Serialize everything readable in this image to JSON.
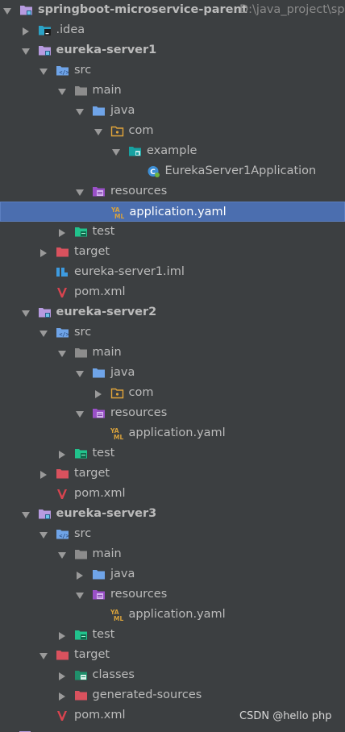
{
  "tree": {
    "rows": [
      {
        "name": "project-root",
        "indent": 0,
        "arrow": "down",
        "icon": "module-folder",
        "label": "springboot-microservice-parent",
        "bold": true,
        "path": "D:\\java_project\\sp"
      },
      {
        "name": "idea-folder",
        "indent": 1,
        "arrow": "right",
        "icon": "idea-folder",
        "label": ".idea"
      },
      {
        "name": "module-eureka-server1",
        "indent": 1,
        "arrow": "down",
        "icon": "module-folder",
        "label": "eureka-server1",
        "bold": true
      },
      {
        "name": "src-folder",
        "indent": 2,
        "arrow": "down",
        "icon": "src-folder",
        "label": "src"
      },
      {
        "name": "main-folder",
        "indent": 3,
        "arrow": "down",
        "icon": "plain-folder",
        "label": "main"
      },
      {
        "name": "java-folder",
        "indent": 4,
        "arrow": "down",
        "icon": "java-folder",
        "label": "java"
      },
      {
        "name": "package-com",
        "indent": 5,
        "arrow": "down",
        "icon": "package-folder",
        "label": "com"
      },
      {
        "name": "package-example",
        "indent": 6,
        "arrow": "down",
        "icon": "package-teal",
        "label": "example"
      },
      {
        "name": "class-eurekaserver1application",
        "indent": 7,
        "arrow": "none",
        "icon": "spring-class",
        "label": "EurekaServer1Application"
      },
      {
        "name": "resources-folder",
        "indent": 4,
        "arrow": "down",
        "icon": "resources-folder",
        "label": "resources"
      },
      {
        "name": "file-application-yaml",
        "indent": 5,
        "arrow": "none",
        "icon": "yaml-file",
        "label": "application.yaml",
        "selected": true
      },
      {
        "name": "test-folder",
        "indent": 3,
        "arrow": "right",
        "icon": "test-folder",
        "label": "test"
      },
      {
        "name": "target-folder",
        "indent": 2,
        "arrow": "right",
        "icon": "target-folder",
        "label": "target"
      },
      {
        "name": "file-eureka-server1-iml",
        "indent": 2,
        "arrow": "none",
        "icon": "iml-file",
        "label": "eureka-server1.iml"
      },
      {
        "name": "file-pom-xml",
        "indent": 2,
        "arrow": "none",
        "icon": "maven-file",
        "label": "pom.xml"
      },
      {
        "name": "module-eureka-server2",
        "indent": 1,
        "arrow": "down",
        "icon": "module-folder",
        "label": "eureka-server2",
        "bold": true
      },
      {
        "name": "src-folder",
        "indent": 2,
        "arrow": "down",
        "icon": "src-folder",
        "label": "src"
      },
      {
        "name": "main-folder",
        "indent": 3,
        "arrow": "down",
        "icon": "plain-folder",
        "label": "main"
      },
      {
        "name": "java-folder",
        "indent": 4,
        "arrow": "down",
        "icon": "java-folder",
        "label": "java"
      },
      {
        "name": "package-com",
        "indent": 5,
        "arrow": "right",
        "icon": "package-folder",
        "label": "com"
      },
      {
        "name": "resources-folder",
        "indent": 4,
        "arrow": "down",
        "icon": "resources-folder",
        "label": "resources"
      },
      {
        "name": "file-application-yaml",
        "indent": 5,
        "arrow": "none",
        "icon": "yaml-file",
        "label": "application.yaml"
      },
      {
        "name": "test-folder",
        "indent": 3,
        "arrow": "right",
        "icon": "test-folder",
        "label": "test"
      },
      {
        "name": "target-folder",
        "indent": 2,
        "arrow": "right",
        "icon": "target-folder",
        "label": "target"
      },
      {
        "name": "file-pom-xml",
        "indent": 2,
        "arrow": "none",
        "icon": "maven-file",
        "label": "pom.xml"
      },
      {
        "name": "module-eureka-server3",
        "indent": 1,
        "arrow": "down",
        "icon": "module-folder",
        "label": "eureka-server3",
        "bold": true
      },
      {
        "name": "src-folder",
        "indent": 2,
        "arrow": "down",
        "icon": "src-folder",
        "label": "src"
      },
      {
        "name": "main-folder",
        "indent": 3,
        "arrow": "down",
        "icon": "plain-folder",
        "label": "main"
      },
      {
        "name": "java-folder",
        "indent": 4,
        "arrow": "right",
        "icon": "java-folder",
        "label": "java"
      },
      {
        "name": "resources-folder",
        "indent": 4,
        "arrow": "down",
        "icon": "resources-folder",
        "label": "resources"
      },
      {
        "name": "file-application-yaml",
        "indent": 5,
        "arrow": "none",
        "icon": "yaml-file",
        "label": "application.yaml"
      },
      {
        "name": "test-folder",
        "indent": 3,
        "arrow": "right",
        "icon": "test-folder",
        "label": "test"
      },
      {
        "name": "target-folder",
        "indent": 2,
        "arrow": "down",
        "icon": "target-folder",
        "label": "target"
      },
      {
        "name": "classes-folder",
        "indent": 3,
        "arrow": "right",
        "icon": "classes-folder",
        "label": "classes"
      },
      {
        "name": "generated-sources-folder",
        "indent": 3,
        "arrow": "right",
        "icon": "target-folder",
        "label": "generated-sources"
      },
      {
        "name": "file-pom-xml",
        "indent": 2,
        "arrow": "none",
        "icon": "maven-file",
        "label": "pom.xml"
      }
    ]
  },
  "colors": {
    "background": "#3c3f41",
    "text": "#bbbbbb",
    "selection": "#4b6eaf",
    "module": "#b79be0",
    "src": "#6fa4e8",
    "plain": "#8c8c8c",
    "package": "#e0a43a",
    "teal": "#17a2a2",
    "test": "#21c28c",
    "target": "#d9525e",
    "maven": "#d9444f",
    "yaml": "#d8a23c"
  },
  "watermark": "CSDN @hello php"
}
